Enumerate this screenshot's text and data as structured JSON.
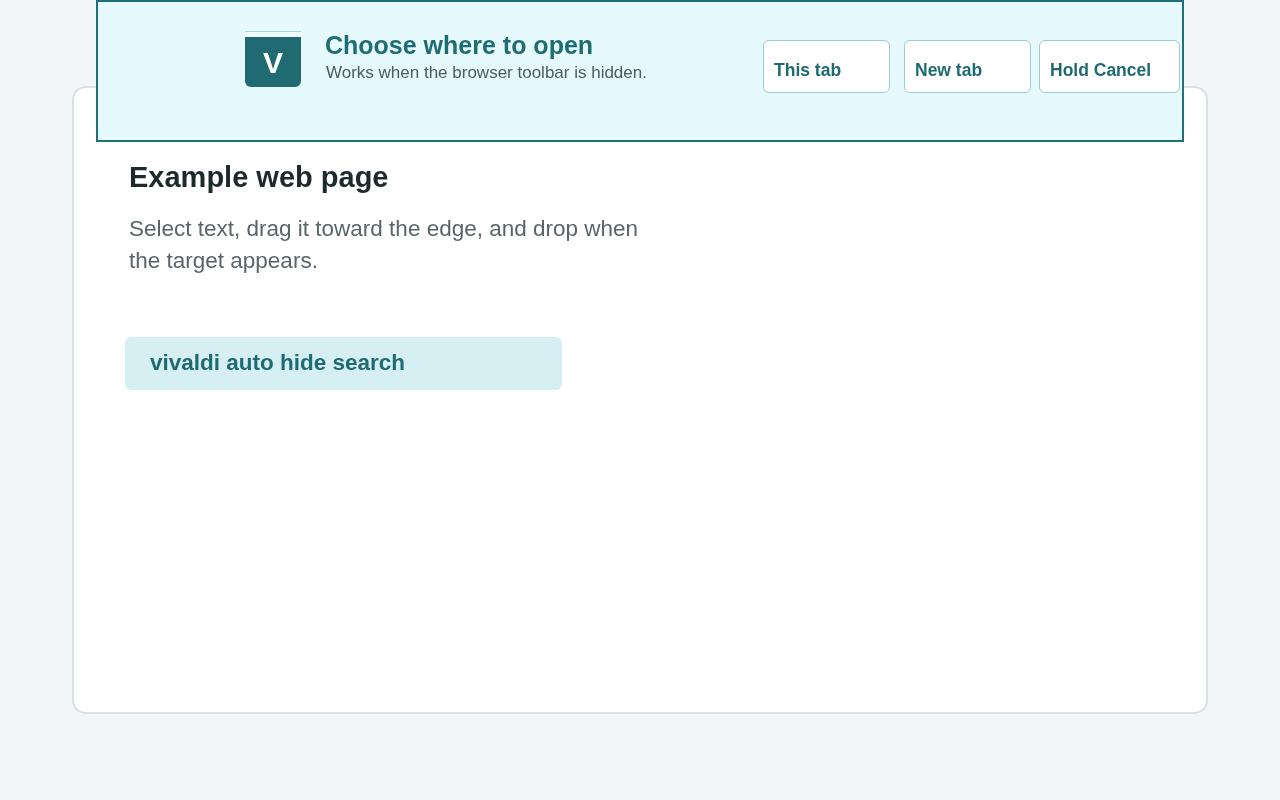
{
  "drop_target": {
    "logo_letter": "V",
    "title": "Choose where to open",
    "subtitle": "Works when the browser toolbar is hidden.",
    "buttons": [
      "This tab",
      "New tab",
      "Hold Cancel"
    ]
  },
  "page": {
    "heading": "Example web page",
    "description": "Select text, drag it toward the edge, and drop when the target appears.",
    "selected_text": "vivaldi auto hide search"
  }
}
